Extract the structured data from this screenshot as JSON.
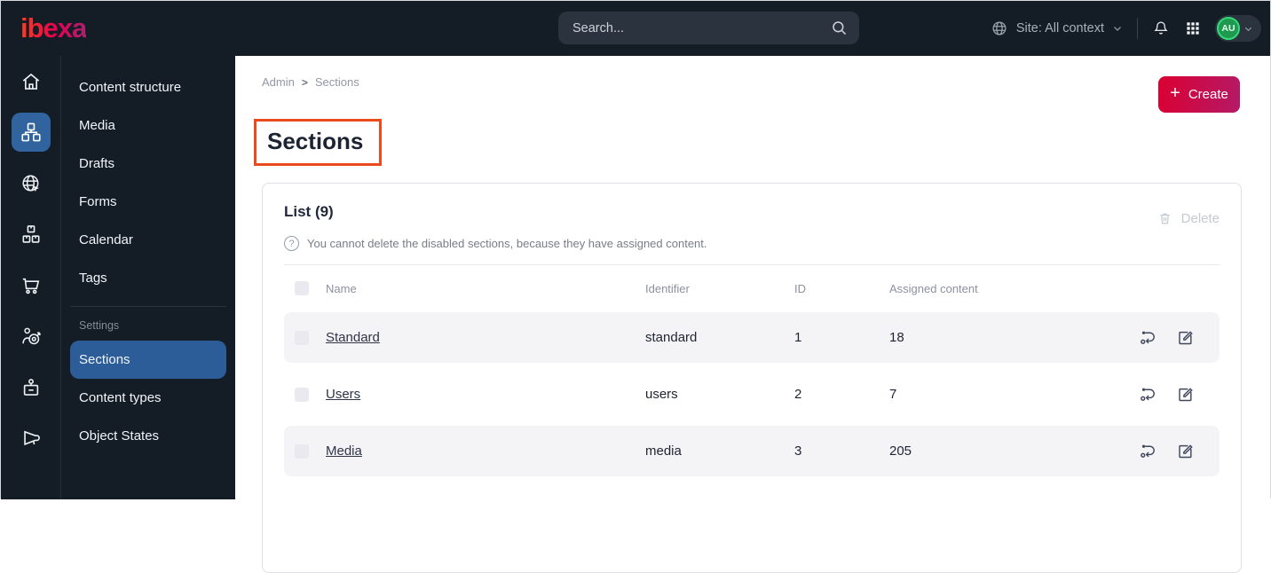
{
  "topbar": {
    "logo": "ibexa",
    "search_placeholder": "Search...",
    "site_context": "Site: All context",
    "avatar_initials": "AU"
  },
  "sidebar": {
    "rail_icons": [
      "home-icon",
      "content-tree-icon",
      "site-globe-icon",
      "product-boxes-icon",
      "cart-icon",
      "personalization-target-icon",
      "admin-badge-icon",
      "megaphone-icon"
    ],
    "active_rail_icon": "content-tree-icon",
    "menu": {
      "items": [
        "Content structure",
        "Media",
        "Drafts",
        "Forms",
        "Calendar",
        "Tags"
      ],
      "settings_label": "Settings",
      "settings_items": [
        "Sections",
        "Content types",
        "Object States"
      ],
      "active_item": "Sections"
    }
  },
  "main": {
    "breadcrumb": [
      "Admin",
      "Sections"
    ],
    "breadcrumb_separator": ">",
    "create_label": "Create",
    "create_plus": "+",
    "page_title": "Sections",
    "list": {
      "title": "List (9)",
      "delete_label": "Delete",
      "info": "You cannot delete the disabled sections, because they have assigned content.",
      "help_glyph": "?",
      "columns": [
        "Name",
        "Identifier",
        "ID",
        "Assigned content"
      ],
      "rows": [
        {
          "name": "Standard",
          "identifier": "standard",
          "id": "1",
          "assigned": "18"
        },
        {
          "name": "Users",
          "identifier": "users",
          "id": "2",
          "assigned": "7"
        },
        {
          "name": "Media",
          "identifier": "media",
          "id": "3",
          "assigned": "205"
        }
      ]
    }
  },
  "colors": {
    "topbar_bg": "#141c26",
    "active_blue": "#31639e",
    "selected_menu_blue": "#2d5d99",
    "create_gradient_start": "#db0032",
    "create_gradient_end": "#b41a67",
    "highlight_orange": "#eb4a1d",
    "avatar_green": "#35d978",
    "row_shade": "#f4f4f6"
  }
}
